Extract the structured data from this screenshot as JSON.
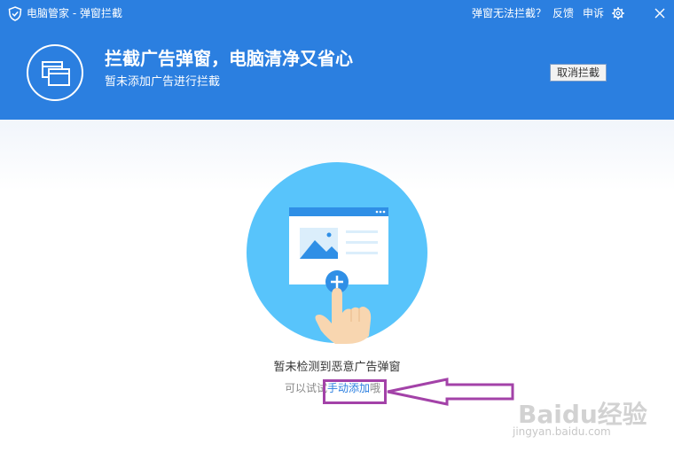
{
  "window": {
    "title": "电脑管家 - 弹窗拦截",
    "links": {
      "cannot_block": "弹窗无法拦截？",
      "feedback": "反馈",
      "complaint": "申诉"
    }
  },
  "header": {
    "headline": "拦截广告弹窗，电脑清净又省心",
    "subline": "暂未添加广告进行拦截",
    "cancel_button": "取消拦截"
  },
  "main": {
    "status": "暂未检测到恶意广告弹窗",
    "hint_prefix": "可以试试",
    "manual_add_link": "手动添加",
    "hint_suffix": "哦"
  },
  "watermark": {
    "brand": "Baidu经验",
    "url": "jingyan.baidu.com"
  },
  "colors": {
    "header_blue": "#2b7fe0",
    "illustration_circle": "#58c4fb",
    "annotation_purple": "#a342a8",
    "link_blue": "#2b7fe0"
  }
}
